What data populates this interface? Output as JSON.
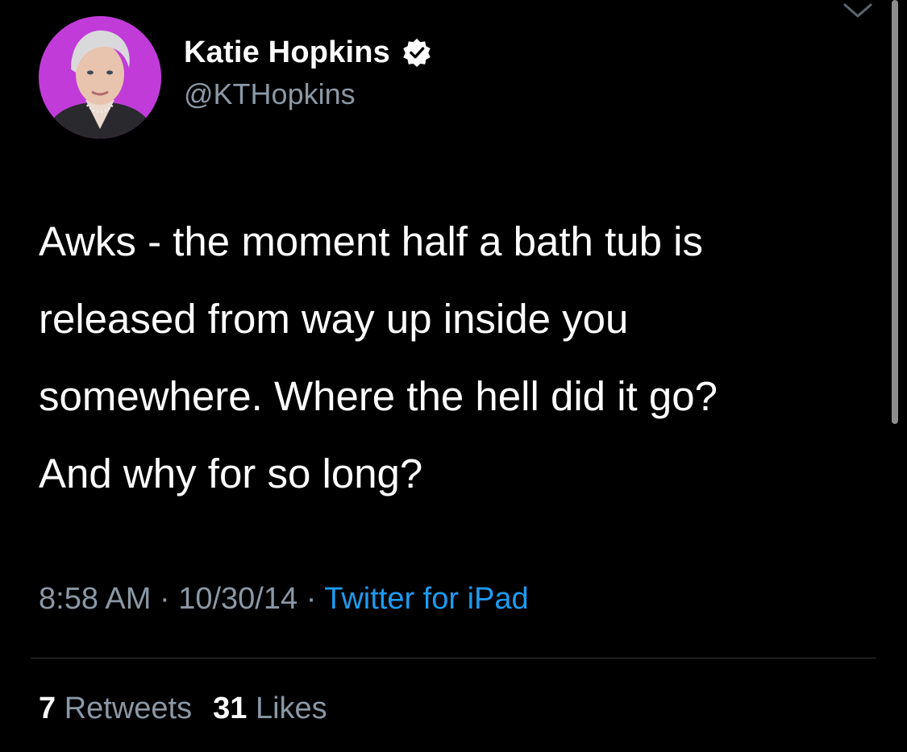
{
  "author": {
    "display_name": "Katie Hopkins",
    "handle": "@KTHopkins",
    "verified": true,
    "avatar_background": "#c13bd9"
  },
  "tweet": {
    "text_lines": [
      "Awks - the moment half a bath tub is",
      "released from way up inside you",
      "somewhere. Where the hell did it go?",
      "And why for so long?"
    ],
    "time": "8:58 AM",
    "date": "10/30/14",
    "separator": "·",
    "source": "Twitter for iPad"
  },
  "stats": {
    "retweets_count": "7",
    "retweets_label": "Retweets",
    "likes_count": "31",
    "likes_label": "Likes"
  },
  "icons": {
    "verified": "verified-badge-icon",
    "menu": "chevron-down-icon"
  },
  "colors": {
    "background": "#000000",
    "text_primary": "#ffffff",
    "text_secondary": "#8b98a5",
    "link": "#1d9bf0",
    "divider": "#2f3336"
  }
}
